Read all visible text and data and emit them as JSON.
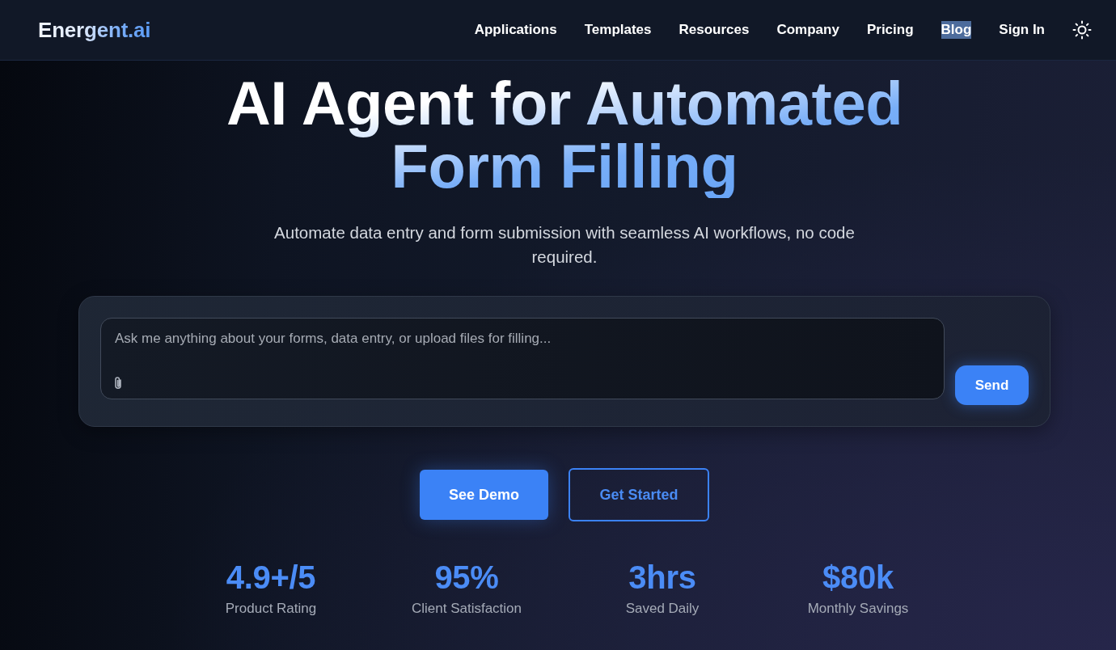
{
  "header": {
    "logo": "Energent.ai",
    "nav": [
      {
        "label": "Applications",
        "selected": false
      },
      {
        "label": "Templates",
        "selected": false
      },
      {
        "label": "Resources",
        "selected": false
      },
      {
        "label": "Company",
        "selected": false
      },
      {
        "label": "Pricing",
        "selected": false
      },
      {
        "label": "Blog",
        "selected": true
      },
      {
        "label": "Sign In",
        "selected": false
      }
    ]
  },
  "hero": {
    "title": "AI Agent for Automated Form Filling",
    "subtitle": "Automate data entry and form submission with seamless AI workflows, no code required.",
    "chat": {
      "placeholder": "Ask me anything about your forms, data entry, or upload files for filling...",
      "send_button": "Send"
    },
    "actions": [
      {
        "label": "See Demo",
        "kind": "primary"
      },
      {
        "label": "Get Started",
        "kind": "outline"
      }
    ],
    "stats": [
      {
        "value": "4.9+/5",
        "label": "Product Rating"
      },
      {
        "value": "95%",
        "label": "Client Satisfaction"
      },
      {
        "value": "3hrs",
        "label": "Saved Daily"
      },
      {
        "value": "$80k",
        "label": "Monthly Savings"
      }
    ]
  }
}
